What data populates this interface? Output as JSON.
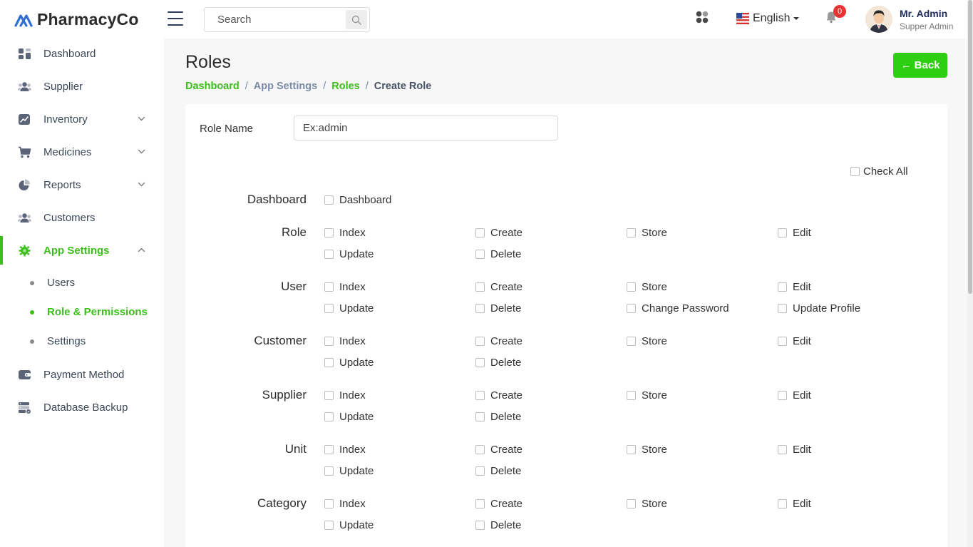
{
  "header": {
    "brand": "PharmacyCo",
    "search_placeholder": "Search",
    "language": "English",
    "notification_count": "0",
    "user_name": "Mr. Admin",
    "user_role": "Supper Admin"
  },
  "sidebar": {
    "items": [
      {
        "label": "Dashboard",
        "icon": "dashboard-icon"
      },
      {
        "label": "Supplier",
        "icon": "users-icon"
      },
      {
        "label": "Inventory",
        "icon": "chart-icon",
        "expandable": true
      },
      {
        "label": "Medicines",
        "icon": "cart-icon",
        "expandable": true
      },
      {
        "label": "Reports",
        "icon": "pie-icon",
        "expandable": true
      },
      {
        "label": "Customers",
        "icon": "users-icon"
      },
      {
        "label": "App Settings",
        "icon": "gear-icon",
        "expandable": true,
        "active": true
      },
      {
        "label": "Payment Method",
        "icon": "wallet-icon"
      },
      {
        "label": "Database Backup",
        "icon": "database-icon"
      }
    ],
    "sub_items": [
      {
        "label": "Users"
      },
      {
        "label": "Role & Permissions",
        "active": true
      },
      {
        "label": "Settings"
      }
    ]
  },
  "page": {
    "title": "Roles",
    "breadcrumb": [
      "Dashboard",
      "App Settings",
      "Roles",
      "Create Role"
    ],
    "back_label": "← Back"
  },
  "form": {
    "role_name_label": "Role Name",
    "role_name_placeholder": "Ex:admin",
    "check_all_label": "Check All",
    "modules": [
      {
        "name": "Dashboard",
        "permissions": [
          "Dashboard"
        ]
      },
      {
        "name": "Role",
        "permissions": [
          "Index",
          "Create",
          "Store",
          "Edit",
          "Update",
          "Delete"
        ]
      },
      {
        "name": "User",
        "permissions": [
          "Index",
          "Create",
          "Store",
          "Edit",
          "Update",
          "Delete",
          "Change Password",
          "Update Profile"
        ]
      },
      {
        "name": "Customer",
        "permissions": [
          "Index",
          "Create",
          "Store",
          "Edit",
          "Update",
          "Delete"
        ]
      },
      {
        "name": "Supplier",
        "permissions": [
          "Index",
          "Create",
          "Store",
          "Edit",
          "Update",
          "Delete"
        ]
      },
      {
        "name": "Unit",
        "permissions": [
          "Index",
          "Create",
          "Store",
          "Edit",
          "Update",
          "Delete"
        ]
      },
      {
        "name": "Category",
        "permissions": [
          "Index",
          "Create",
          "Store",
          "Edit",
          "Update",
          "Delete"
        ]
      }
    ]
  },
  "colors": {
    "accent": "#3cbf1b",
    "button": "#2ece12",
    "badge": "#e73333"
  }
}
